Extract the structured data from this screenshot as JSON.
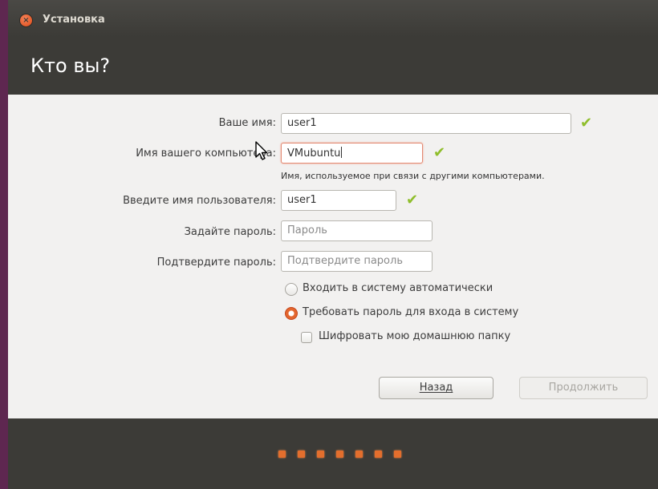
{
  "window": {
    "title": "Установка"
  },
  "page": {
    "title": "Кто вы?"
  },
  "form": {
    "your_name": {
      "label": "Ваше имя:",
      "value": "user1"
    },
    "computer_name": {
      "label": "Имя вашего компьютера:",
      "value": "VMubuntu",
      "hint": "Имя, используемое при связи с другими компьютерами."
    },
    "username": {
      "label": "Введите имя пользователя:",
      "value": "user1"
    },
    "password": {
      "label": "Задайте пароль:",
      "placeholder": "Пароль"
    },
    "confirm": {
      "label": "Подтвердите пароль:",
      "placeholder": "Подтвердите пароль"
    },
    "options": {
      "auto_login": "Входить в систему автоматически",
      "require_password": "Требовать пароль для входа в систему",
      "encrypt_home": "Шифровать мою домашнюю папку"
    },
    "selected_option": "require_password",
    "encrypt_checked": false
  },
  "buttons": {
    "back": "Назад",
    "continue": "Продолжить"
  },
  "progress": {
    "steps": 7
  },
  "colors": {
    "accent": "#e36e2d",
    "check": "#8fbe2b",
    "dark": "#3c3b37"
  }
}
